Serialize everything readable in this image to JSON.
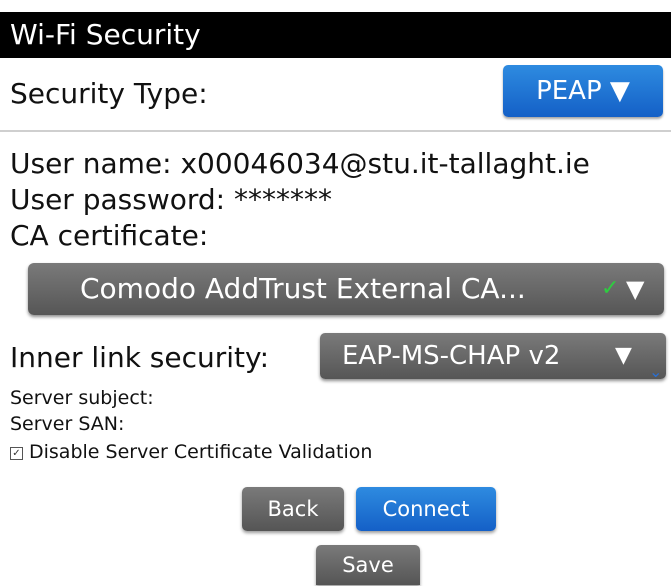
{
  "header": {
    "title": "Wi-Fi Security"
  },
  "security_type": {
    "label": "Security Type:",
    "value": "PEAP",
    "arrow": "▼"
  },
  "credentials": {
    "user_name": "User name: x00046034@stu.it-tallaght.ie",
    "user_password": "User password: *******",
    "ca_label": "CA certificate:"
  },
  "ca_certificate": {
    "value": "Comodo AddTrust External CA...",
    "check": "✓",
    "arrow": "▼"
  },
  "inner_link": {
    "label": "Inner link security:",
    "value": "EAP-MS-CHAP v2",
    "arrow": "▼",
    "scroll_hint": "⌄"
  },
  "server": {
    "subject": "Server subject:",
    "san": "Server SAN:",
    "disable_validation": {
      "label": "Disable Server Certificate Validation",
      "checked": true,
      "mark": "✓"
    }
  },
  "buttons": {
    "back": "Back",
    "connect": "Connect",
    "save": "Save"
  },
  "colors": {
    "accent_blue": "#1f78d8",
    "button_gray": "#666666",
    "title_bar": "#000000"
  }
}
